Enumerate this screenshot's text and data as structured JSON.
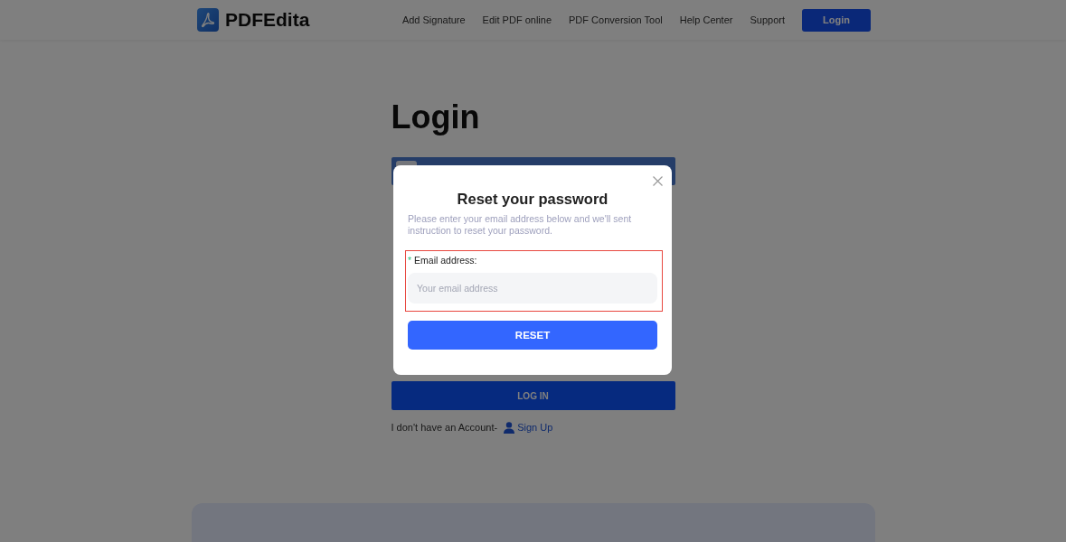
{
  "header": {
    "logo_text": "PDFEdita",
    "nav": [
      {
        "label": "Add Signature"
      },
      {
        "label": "Edit PDF online"
      },
      {
        "label": "PDF Conversion Tool"
      },
      {
        "label": "Help Center"
      },
      {
        "label": "Support"
      }
    ],
    "login_button": "Login"
  },
  "page": {
    "title": "Login",
    "login_button": "LOG IN",
    "signup_prompt": "I don't have an Account-",
    "signup_link": "Sign Up"
  },
  "modal": {
    "title": "Reset your password",
    "description": "Please enter your email address below and we'll sent instruction to reset your password.",
    "email_field": {
      "required_mark": "*",
      "label": "Email address:",
      "placeholder": "Your email address",
      "highlighted": true
    },
    "submit_button": "RESET"
  }
}
